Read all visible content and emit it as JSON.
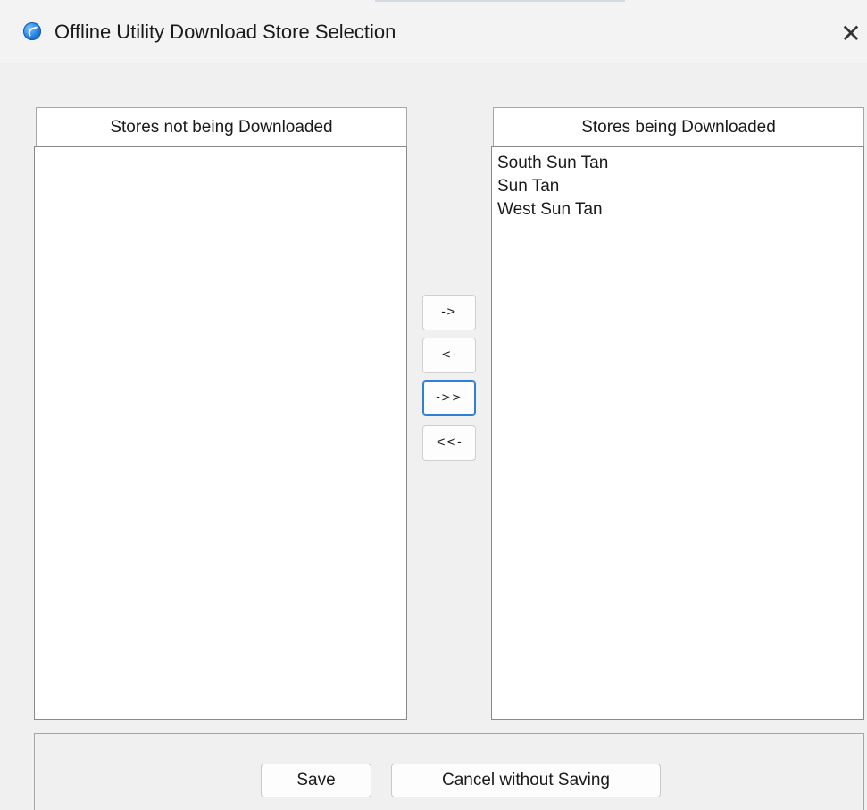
{
  "window": {
    "title": "Offline Utility Download Store Selection",
    "close_glyph": "✕",
    "app_icon": "app-logo-icon"
  },
  "left_list": {
    "header": "Stores not being Downloaded",
    "items": []
  },
  "right_list": {
    "header": "Stores being Downloaded",
    "items": [
      "South Sun Tan",
      "Sun Tan",
      "West Sun Tan"
    ]
  },
  "transfer_buttons": {
    "move_right": "->",
    "move_left": "<-",
    "move_all_right": "->>",
    "move_all_left": "<<-"
  },
  "footer": {
    "save_label": "Save",
    "cancel_label": "Cancel without Saving"
  },
  "colors": {
    "background": "#f0f0f0",
    "focus_accent": "#2f7fd6",
    "icon_blue": "#1f7fe0"
  }
}
